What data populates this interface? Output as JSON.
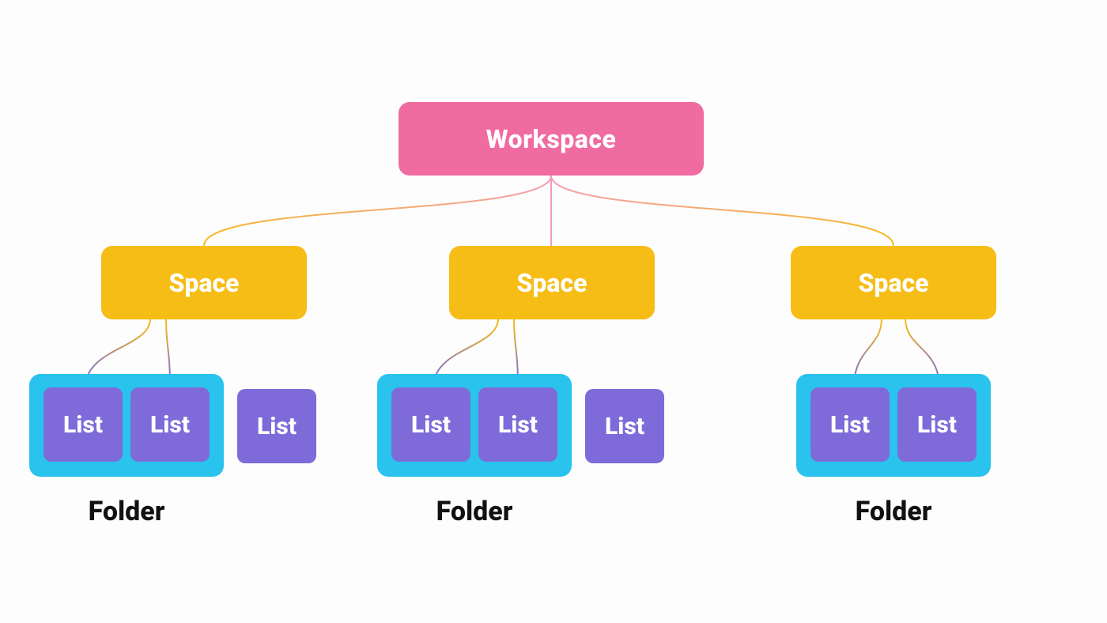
{
  "colors": {
    "workspace": "#f06ba0",
    "space": "#f6bd16",
    "folder": "#29c3ed",
    "list": "#7e6bd9",
    "connector_pink": "#f29bbd",
    "connector_yellow": "#f6bd16",
    "connector_purple": "#7e6bd9"
  },
  "hierarchy": {
    "workspace": {
      "label": "Workspace",
      "children": [
        {
          "label": "Space",
          "folder": {
            "label": "Folder",
            "lists": [
              "List",
              "List"
            ]
          },
          "standalone_lists": [
            "List"
          ]
        },
        {
          "label": "Space",
          "folder": {
            "label": "Folder",
            "lists": [
              "List",
              "List"
            ]
          },
          "standalone_lists": [
            "List"
          ]
        },
        {
          "label": "Space",
          "folder": {
            "label": "Folder",
            "lists": [
              "List",
              "List"
            ]
          },
          "standalone_lists": []
        }
      ]
    }
  }
}
